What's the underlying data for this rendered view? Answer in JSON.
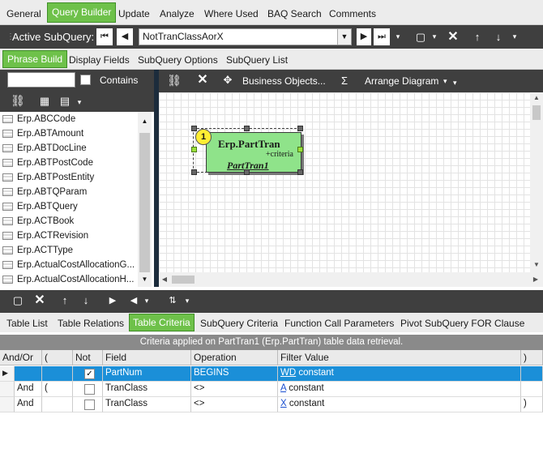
{
  "top_tabs": [
    {
      "label": "General"
    },
    {
      "label": "Query Builder",
      "active": true
    },
    {
      "label": "Update"
    },
    {
      "label": "Analyze"
    },
    {
      "label": "Where Used"
    },
    {
      "label": "BAQ Search"
    },
    {
      "label": "Comments"
    }
  ],
  "subquery": {
    "label": "Active SubQuery:",
    "value": "NotTranClassAorX"
  },
  "sub_tabs": [
    {
      "label": "Phrase Build",
      "active": true
    },
    {
      "label": "Display Fields"
    },
    {
      "label": "SubQuery Options"
    },
    {
      "label": "SubQuery List"
    }
  ],
  "search": {
    "value": "",
    "contains_label": "Contains",
    "contains_checked": false
  },
  "diagram_toolbar": {
    "business_objects": "Business Objects...",
    "sum_symbol": "Σ",
    "arrange": "Arrange Diagram"
  },
  "tables": [
    "Erp.ABCCode",
    "Erp.ABTAmount",
    "Erp.ABTDocLine",
    "Erp.ABTPostCode",
    "Erp.ABTPostEntity",
    "Erp.ABTQParam",
    "Erp.ABTQuery",
    "Erp.ACTBook",
    "Erp.ACTRevision",
    "Erp.ACTType",
    "Erp.ActualCostAllocationG...",
    "Erp.ActualCostAllocationH..."
  ],
  "node": {
    "badge": "1",
    "table": "Erp.PartTran",
    "criteria": "+criteria",
    "alias": "PartTran1"
  },
  "bottom_tabs": [
    {
      "label": "Table List"
    },
    {
      "label": "Table Relations"
    },
    {
      "label": "Table Criteria",
      "active": true
    },
    {
      "label": "SubQuery Criteria"
    },
    {
      "label": "Function Call Parameters"
    },
    {
      "label": "Pivot SubQuery FOR Clause"
    }
  ],
  "caption": "Criteria applied on PartTran1 (Erp.PartTran)  table data retrieval.",
  "grid": {
    "headers": [
      "And/Or",
      "(",
      "Not",
      "Field",
      "Operation",
      "Filter Value",
      ")"
    ],
    "rows": [
      {
        "andor": "",
        "open": "",
        "not": true,
        "field": "PartNum",
        "operation": "BEGINS",
        "filter_link": "WD",
        "filter_type": "constant",
        "close": "",
        "selected": true
      },
      {
        "andor": "And",
        "open": "(",
        "not": false,
        "field": "TranClass",
        "operation": "<>",
        "filter_link": "A",
        "filter_type": "constant",
        "close": ""
      },
      {
        "andor": "And",
        "open": "",
        "not": false,
        "field": "TranClass",
        "operation": "<>",
        "filter_link": "X",
        "filter_type": "constant",
        "close": ")"
      }
    ]
  }
}
